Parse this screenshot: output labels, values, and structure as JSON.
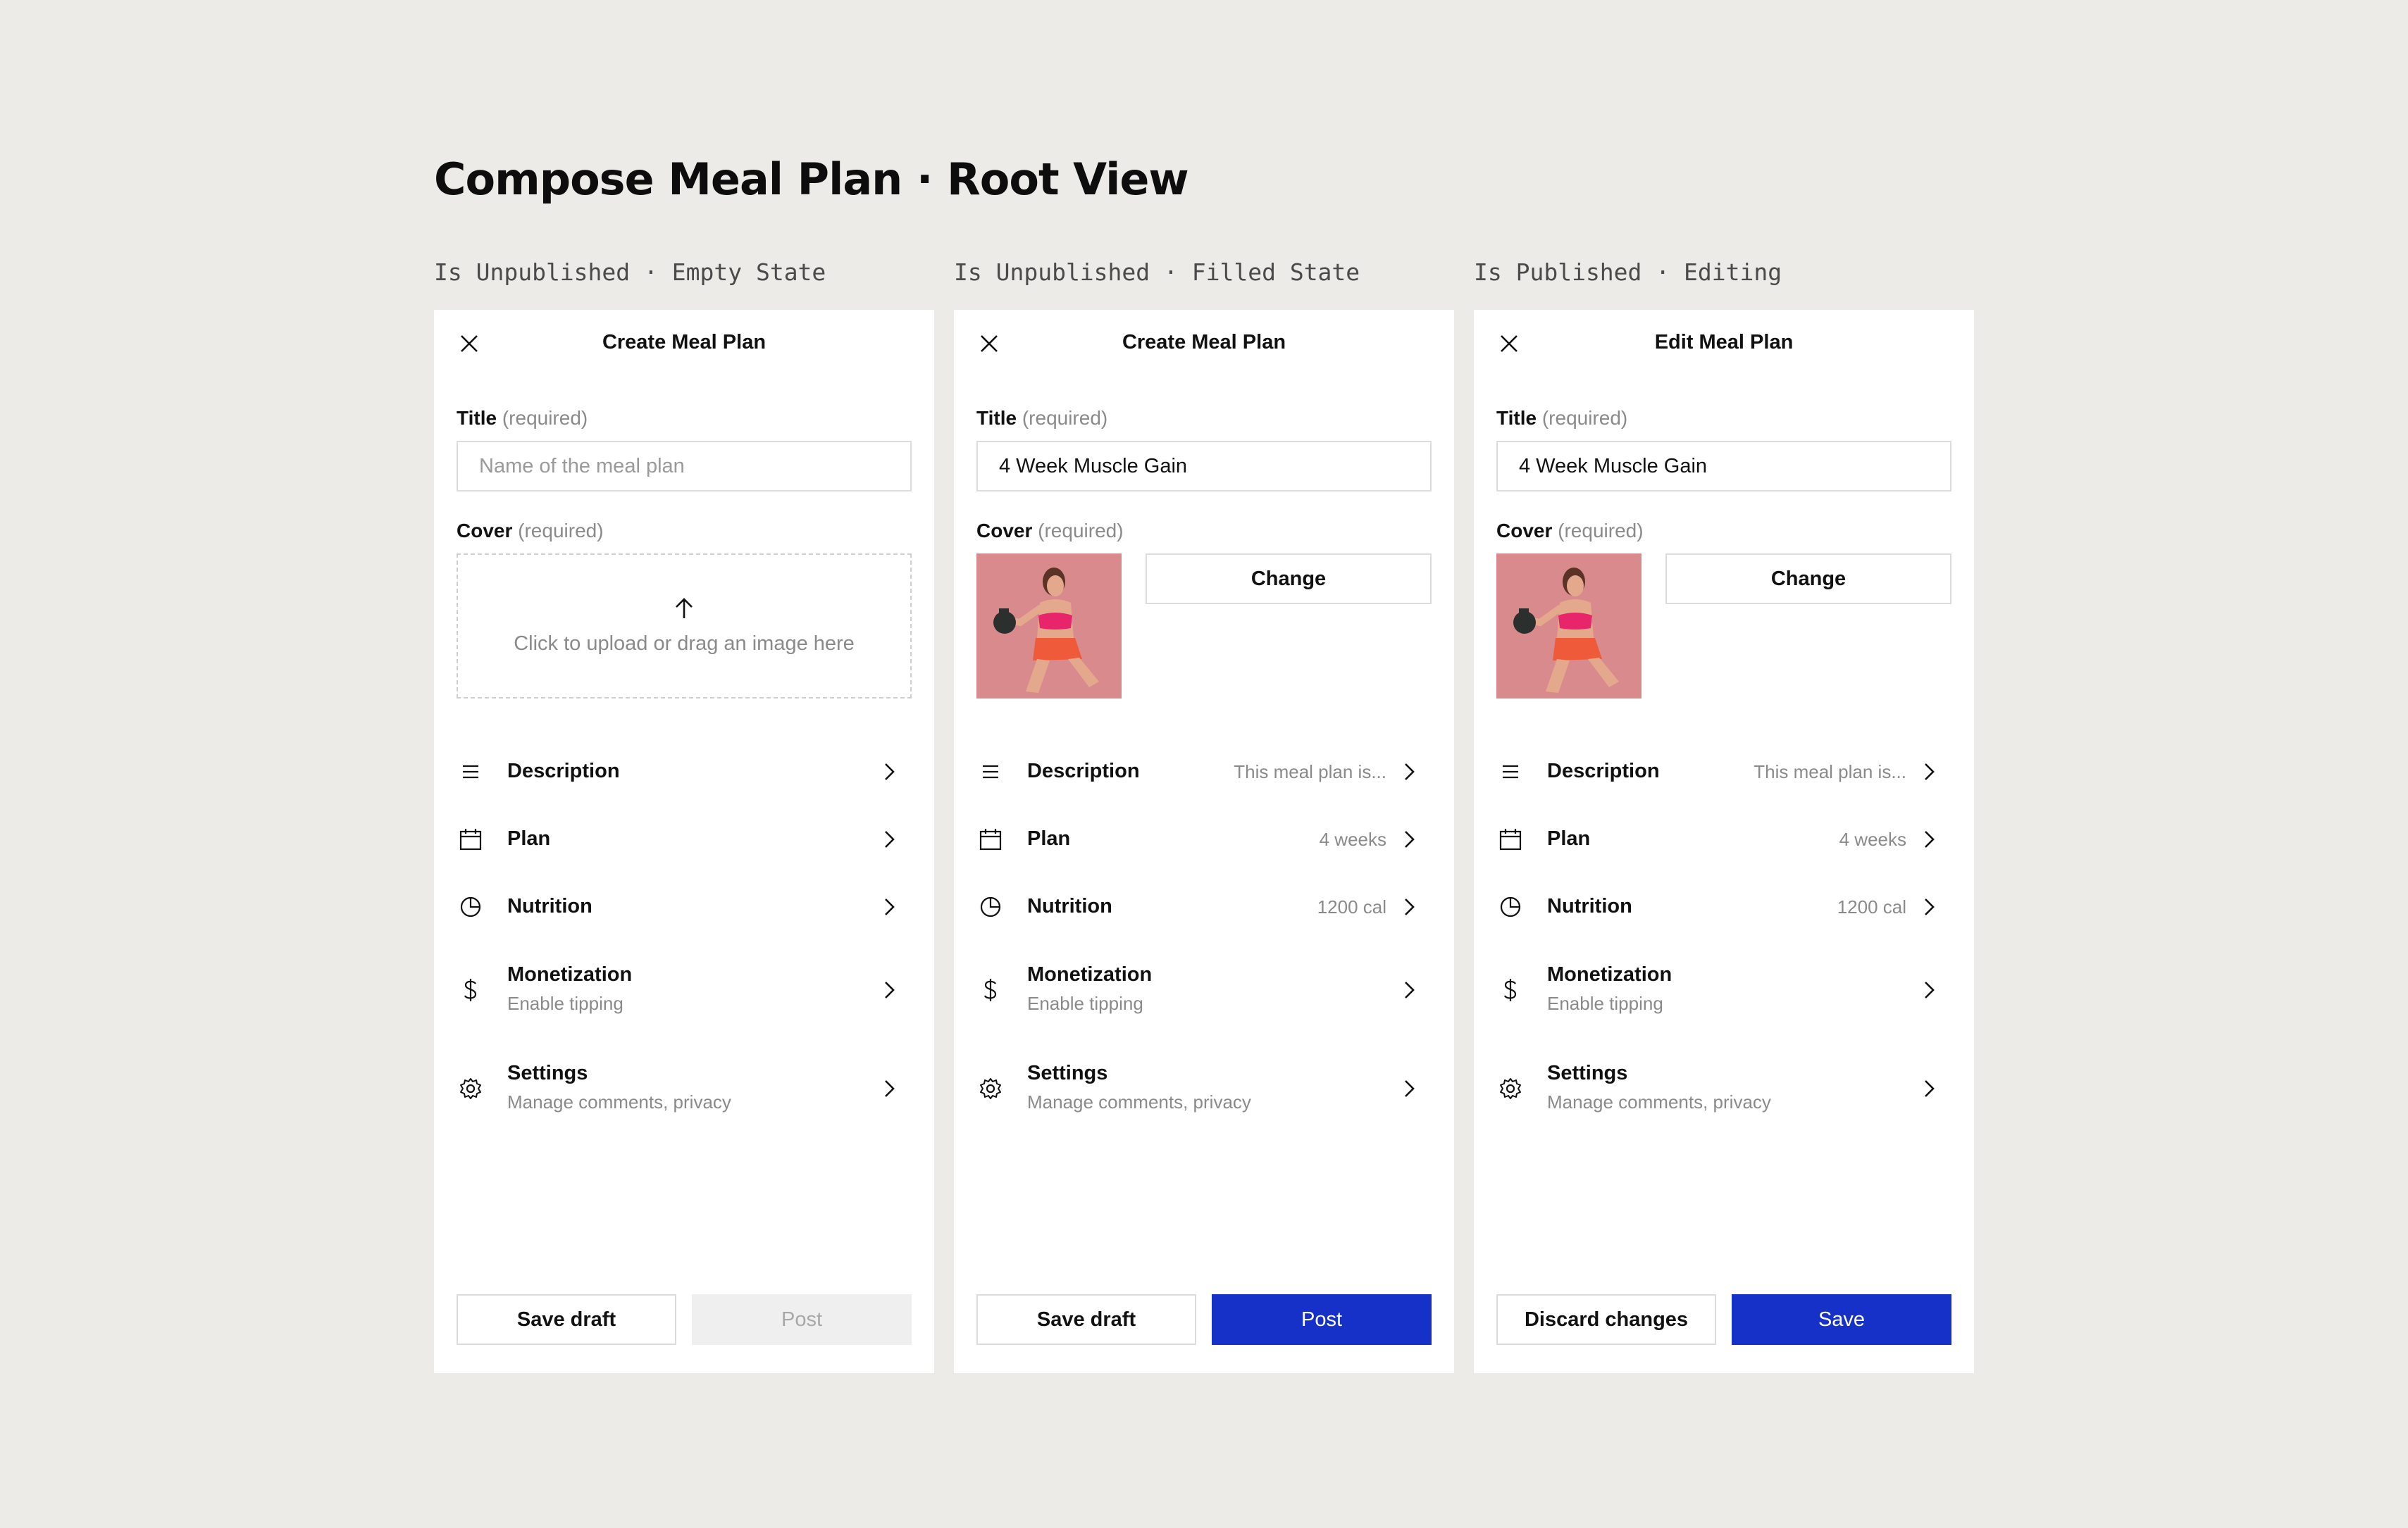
{
  "page_title": "Compose Meal Plan · Root View",
  "colors": {
    "background": "#edebe8",
    "panel": "#ffffff",
    "primary": "#1631c8",
    "disabled": "#efefef"
  },
  "variants": [
    {
      "label": "Is Unpublished · Empty State",
      "header_title": "Create Meal Plan",
      "title_label": "Title",
      "title_req": "(required)",
      "title_value": "",
      "title_placeholder": "Name of the meal plan",
      "cover_label": "Cover",
      "cover_req": "(required)",
      "upload_text": "Click to upload or drag an image here",
      "menu": [
        {
          "icon": "lines-icon",
          "label": "Description",
          "value": ""
        },
        {
          "icon": "calendar-icon",
          "label": "Plan",
          "value": ""
        },
        {
          "icon": "pie-chart-icon",
          "label": "Nutrition",
          "value": ""
        },
        {
          "icon": "dollar-icon",
          "label": "Monetization",
          "sub": "Enable tipping"
        },
        {
          "icon": "gear-icon",
          "label": "Settings",
          "sub": "Manage comments, privacy"
        }
      ],
      "btn_left": "Save draft",
      "btn_right": "Post",
      "btn_right_state": "disabled"
    },
    {
      "label": "Is Unpublished · Filled State",
      "header_title": "Create Meal Plan",
      "title_label": "Title",
      "title_req": "(required)",
      "title_value": "4 Week Muscle Gain",
      "title_placeholder": "Name of the meal plan",
      "cover_label": "Cover",
      "cover_req": "(required)",
      "change_label": "Change",
      "menu": [
        {
          "icon": "lines-icon",
          "label": "Description",
          "value": "This meal plan is..."
        },
        {
          "icon": "calendar-icon",
          "label": "Plan",
          "value": "4 weeks"
        },
        {
          "icon": "pie-chart-icon",
          "label": "Nutrition",
          "value": "1200 cal"
        },
        {
          "icon": "dollar-icon",
          "label": "Monetization",
          "sub": "Enable tipping"
        },
        {
          "icon": "gear-icon",
          "label": "Settings",
          "sub": "Manage comments, privacy"
        }
      ],
      "btn_left": "Save draft",
      "btn_right": "Post",
      "btn_right_state": "primary"
    },
    {
      "label": "Is Published · Editing",
      "header_title": "Edit Meal Plan",
      "title_label": "Title",
      "title_req": "(required)",
      "title_value": "4 Week Muscle Gain",
      "title_placeholder": "Name of the meal plan",
      "cover_label": "Cover",
      "cover_req": "(required)",
      "change_label": "Change",
      "menu": [
        {
          "icon": "lines-icon",
          "label": "Description",
          "value": "This meal plan is..."
        },
        {
          "icon": "calendar-icon",
          "label": "Plan",
          "value": "4 weeks"
        },
        {
          "icon": "pie-chart-icon",
          "label": "Nutrition",
          "value": "1200 cal"
        },
        {
          "icon": "dollar-icon",
          "label": "Monetization",
          "sub": "Enable tipping"
        },
        {
          "icon": "gear-icon",
          "label": "Settings",
          "sub": "Manage comments, privacy"
        }
      ],
      "btn_left": "Discard changes",
      "btn_right": "Save",
      "btn_right_state": "primary"
    }
  ]
}
